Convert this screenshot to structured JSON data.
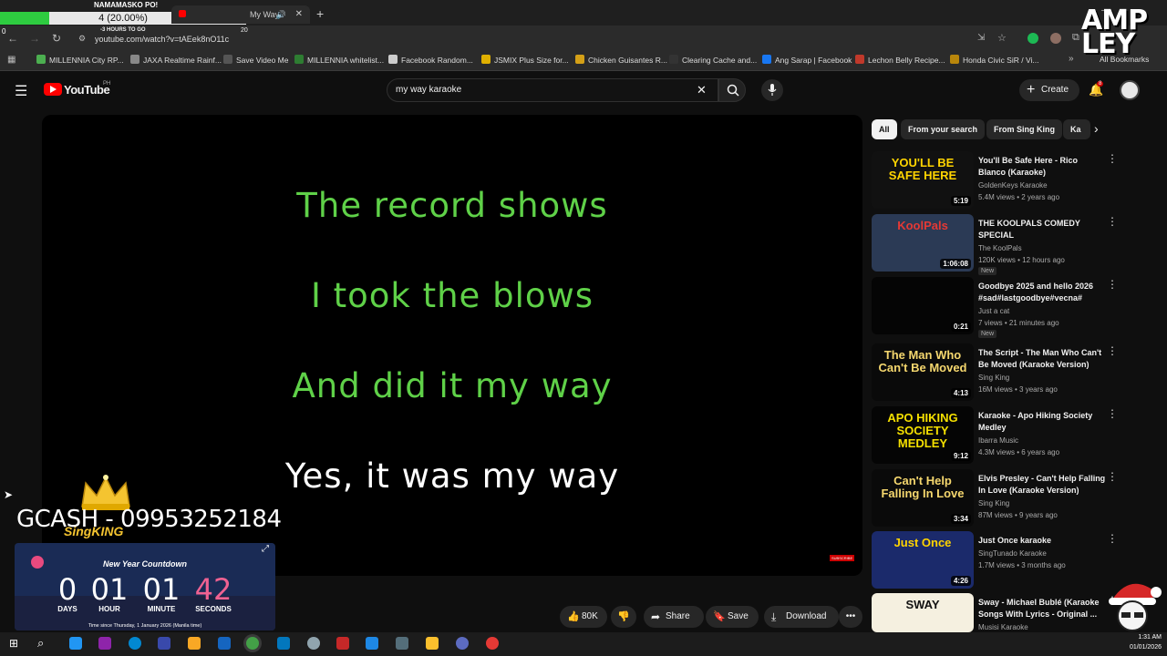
{
  "browser": {
    "stream_title": "NAMAMASKO PO!",
    "progress_text": "4 (20.00%)",
    "progress_fraction": 0.2,
    "tab_title": "My Way",
    "countdown_small": "-3 HOURS TO GO",
    "countdown_small_num": "20",
    "url": "youtube.com/watch?v=tAEek8nO11c",
    "back_num": "0",
    "bookmarks": [
      {
        "label": "MILLENNIA City RP...",
        "color": "#4caf50"
      },
      {
        "label": "JAXA Realtime Rainf...",
        "color": "#888888"
      },
      {
        "label": "Save Video Me",
        "color": "#555555"
      },
      {
        "label": "MILLENNIA whitelist...",
        "color": "#2e7d32"
      },
      {
        "label": "Facebook Random...",
        "color": "#cccccc"
      },
      {
        "label": "JSMIX Plus Size for...",
        "color": "#e0b000"
      },
      {
        "label": "Chicken Guisantes R...",
        "color": "#d4a017"
      },
      {
        "label": "Clearing Cache and...",
        "color": "#333333"
      },
      {
        "label": "Ang Sarap | Facebook",
        "color": "#1877f2"
      },
      {
        "label": "Lechon Belly Recipe...",
        "color": "#c0392b"
      },
      {
        "label": "Honda Civic SiR / Vi...",
        "color": "#b8860b"
      }
    ],
    "all_bookmarks": "All Bookmarks"
  },
  "youtube": {
    "logo": "YouTube",
    "logo_region": "PH",
    "search_value": "my way karaoke",
    "create_label": "Create",
    "notification_count": "8",
    "like_count": "80K",
    "share_label": "Share",
    "save_label": "Save",
    "download_label": "Download"
  },
  "video": {
    "lyrics": [
      {
        "text": "The record shows",
        "color": "#5fd148"
      },
      {
        "text": "I took the blows",
        "color": "#5fd148"
      },
      {
        "text": "And did it my way",
        "color": "#5fd148"
      },
      {
        "text": "Yes, it was my way",
        "color": "#ffffff"
      }
    ],
    "subscribe_watermark": "SUBSCRIBE"
  },
  "overlay": {
    "gcash": "GCASH - 09953252184",
    "brand": "SingKING",
    "countdown_title": "New Year Countdown",
    "days": "0",
    "days_label": "DAYS",
    "hour": "01",
    "hour_label": "HOUR",
    "minute": "01",
    "minute_label": "MINUTE",
    "seconds": "42",
    "seconds_label": "SECONDS",
    "countdown_footer": "Time since Thursday, 1 January 2026 (Manila time)",
    "ampley": "AMP LEY"
  },
  "chips": [
    "All",
    "From your search",
    "From Sing King",
    "Ka"
  ],
  "related": [
    {
      "title": "You'll Be Safe Here - Rico Blanco (Karaoke)",
      "channel": "GoldenKeys Karaoke",
      "meta": "5.4M views • 2 years ago",
      "duration": "5:19",
      "new": "",
      "thumb_text": "YOU'LL BE SAFE HERE",
      "thumb_color": "#111111",
      "thumb_fg": "#ffd400"
    },
    {
      "title": "THE KOOLPALS COMEDY SPECIAL",
      "channel": "The KoolPals",
      "meta": "120K views • 12 hours ago",
      "duration": "1:06:08",
      "new": "New",
      "thumb_text": "KoolPals",
      "thumb_color": "#2b3a55",
      "thumb_fg": "#e53935"
    },
    {
      "title": "Goodbye 2025 and hello 2026 #sad#lastgoodbye#vecna#",
      "channel": "Just a cat",
      "meta": "7 views • 21 minutes ago",
      "duration": "0:21",
      "new": "New",
      "thumb_text": "",
      "thumb_color": "#050505",
      "thumb_fg": "#ffffff"
    },
    {
      "title": "The Script - The Man Who Can't Be Moved (Karaoke Version)",
      "channel": "Sing King",
      "meta": "16M views • 3 years ago",
      "duration": "4:13",
      "new": "",
      "thumb_text": "The Man Who Can't Be Moved",
      "thumb_color": "#0a0a0a",
      "thumb_fg": "#f5d76e"
    },
    {
      "title": "Karaoke - Apo Hiking Society Medley",
      "channel": "Ibarra Music",
      "meta": "4.3M views • 6 years ago",
      "duration": "9:12",
      "new": "",
      "thumb_text": "APO HIKING SOCIETY MEDLEY",
      "thumb_color": "#050505",
      "thumb_fg": "#f5e000"
    },
    {
      "title": "Elvis Presley - Can't Help Falling In Love (Karaoke Version)",
      "channel": "Sing King",
      "meta": "87M views • 9 years ago",
      "duration": "3:34",
      "new": "",
      "thumb_text": "Can't Help Falling In Love",
      "thumb_color": "#0a0a0a",
      "thumb_fg": "#f5d76e"
    },
    {
      "title": "Just Once karaoke",
      "channel": "SingTunado Karaoke",
      "meta": "1.7M views • 3 months ago",
      "duration": "4:26",
      "new": "",
      "thumb_text": "Just Once",
      "thumb_color": "#1b2a6b",
      "thumb_fg": "#ffd400"
    },
    {
      "title": "Sway - Michael Bublé (Karaoke Songs With Lyrics - Original ...",
      "channel": "Musisi Karaoke",
      "meta": "",
      "duration": "",
      "new": "",
      "thumb_text": "SWAY",
      "thumb_color": "#f5f0e0",
      "thumb_fg": "#111111"
    }
  ],
  "taskbar": {
    "time": "1:31 AM",
    "date": "01/01/2026"
  }
}
